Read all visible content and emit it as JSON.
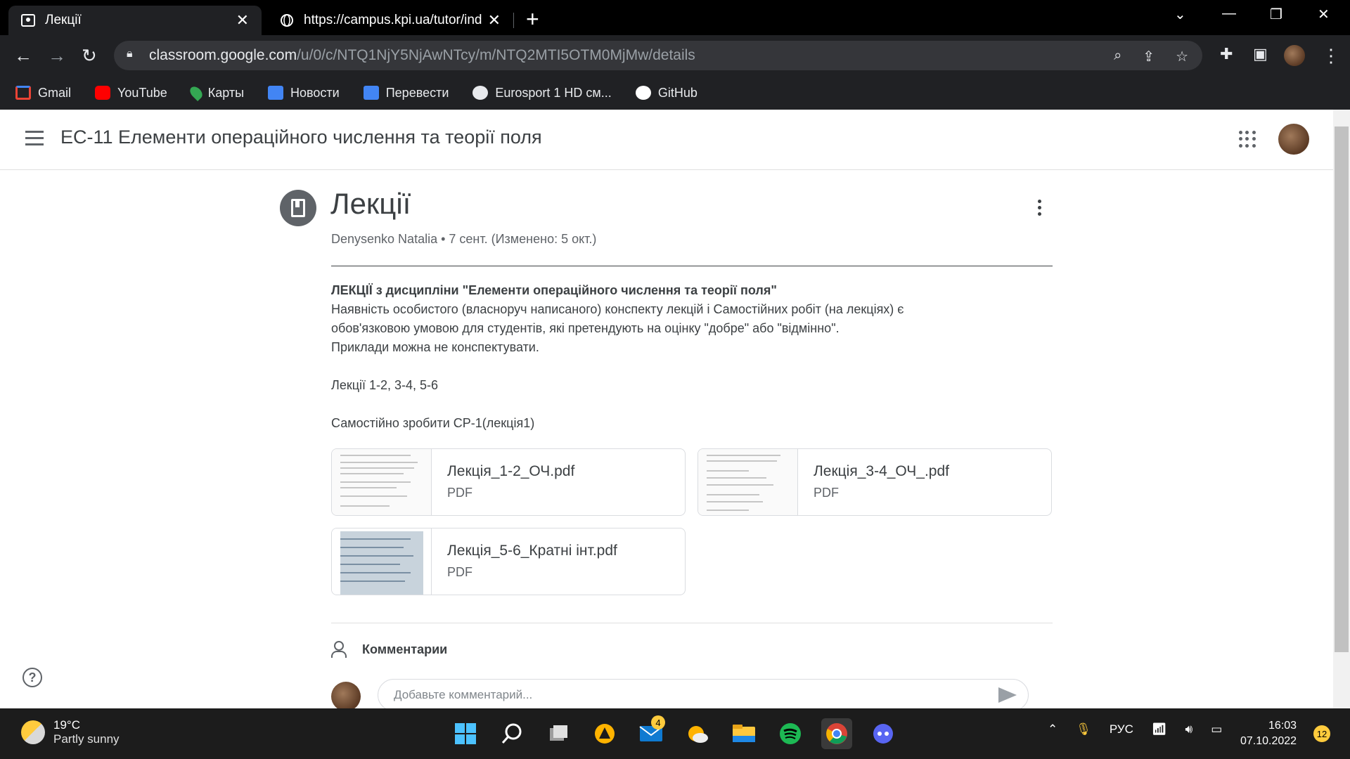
{
  "browser": {
    "tabs": [
      {
        "title": "Лекції",
        "active": true
      },
      {
        "title": "https://campus.kpi.ua/tutor/inde",
        "active": false
      }
    ],
    "url_host": "classroom.google.com",
    "url_path": "/u/0/c/NTQ1NjY5NjAwNTcy/m/NTQ2MTI5OTM0MjMw/details",
    "bookmarks": [
      {
        "label": "Gmail",
        "color": "#ea4335"
      },
      {
        "label": "YouTube",
        "color": "#ff0000"
      },
      {
        "label": "Карты",
        "color": "#34a853"
      },
      {
        "label": "Новости",
        "color": "#4285f4"
      },
      {
        "label": "Перевести",
        "color": "#4285f4"
      },
      {
        "label": "Eurosport 1 HD см...",
        "color": "#ffffff"
      },
      {
        "label": "GitHub",
        "color": "#ffffff"
      }
    ]
  },
  "classroom": {
    "course_title": "ЕС-11 Елементи операційного числення та теорії поля",
    "post": {
      "title": "Лекції",
      "meta": "Denysenko Natalia • 7 сент. (Изменено: 5 окт.)",
      "body_bold": "ЛЕКЦІЇ з дисципліни \"Елементи операційного числення та теорії поля\"",
      "body_lines": [
        "Наявність особистого (власноруч написаного) конспекту лекцій і Самостійних робіт (на лекціях) є",
        "обов'язковою умовою для студентів, які претендують на оцінку \"добре\" або \"відмінно\".",
        "Приклади можна не конспектувати."
      ],
      "lectures_line": "Лекції 1-2, 3-4, 5-6",
      "task_line": "Самостійно зробити СР-1(лекція1)",
      "attachments": [
        {
          "name": "Лекція_1-2_ОЧ.pdf",
          "type": "PDF"
        },
        {
          "name": "Лекція_3-4_ОЧ_.pdf",
          "type": "PDF"
        },
        {
          "name": "Лекція_5-6_Кратні інт.pdf",
          "type": "PDF"
        }
      ]
    },
    "comments_label": "Комментарии",
    "comment_placeholder": "Добавьте комментарий..."
  },
  "taskbar": {
    "weather_temp": "19°C",
    "weather_cond": "Partly sunny",
    "mail_badge": "4",
    "lang": "РУС",
    "time": "16:03",
    "date": "07.10.2022",
    "notifications": "12"
  }
}
